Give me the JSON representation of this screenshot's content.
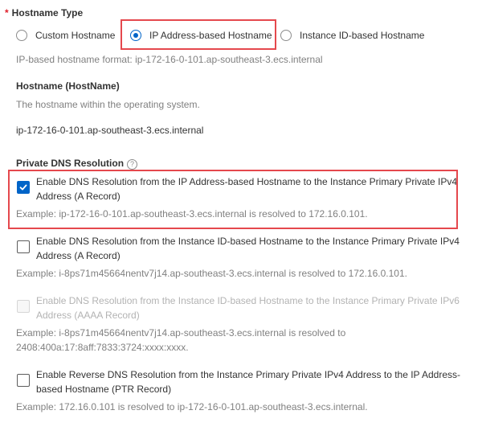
{
  "hostname_type": {
    "label": "Hostname Type",
    "required_mark": "*",
    "options": [
      {
        "label": "Custom Hostname",
        "checked": false
      },
      {
        "label": "IP Address-based Hostname",
        "checked": true
      },
      {
        "label": "Instance ID-based Hostname",
        "checked": false
      }
    ],
    "help": "IP-based hostname format: ip-172-16-0-101.ap-southeast-3.ecs.internal"
  },
  "hostname": {
    "label": "Hostname (HostName)",
    "help": "The hostname within the operating system.",
    "value": "ip-172-16-0-101.ap-southeast-3.ecs.internal"
  },
  "private_dns": {
    "label": "Private DNS Resolution",
    "help_icon": "question-circle-icon",
    "items": [
      {
        "label": "Enable DNS Resolution from the IP Address-based Hostname to the Instance Primary Private IPv4 Address (A Record)",
        "example": "Example: ip-172-16-0-101.ap-southeast-3.ecs.internal is resolved to 172.16.0.101.",
        "checked": true,
        "disabled": false
      },
      {
        "label": "Enable DNS Resolution from the Instance ID-based Hostname to the Instance Primary Private IPv4 Address (A Record)",
        "example": "Example: i-8ps71m45664nentv7j14.ap-southeast-3.ecs.internal is resolved to 172.16.0.101.",
        "checked": false,
        "disabled": false
      },
      {
        "label": "Enable DNS Resolution from the Instance ID-based Hostname to the Instance Primary Private IPv6 Address (AAAA Record)",
        "example": "Example: i-8ps71m45664nentv7j14.ap-southeast-3.ecs.internal is resolved to 2408:400a:17:8aff:7833:3724:xxxx:xxxx.",
        "checked": false,
        "disabled": true
      },
      {
        "label": "Enable Reverse DNS Resolution from the Instance Primary Private IPv4 Address to the IP Address-based Hostname (PTR Record)",
        "example": "Example: 172.16.0.101 is resolved to ip-172-16-0-101.ap-southeast-3.ecs.internal.",
        "checked": false,
        "disabled": false
      }
    ]
  },
  "colors": {
    "accent": "#0064c8",
    "highlight": "#e5484d",
    "required": "#e0202b"
  }
}
